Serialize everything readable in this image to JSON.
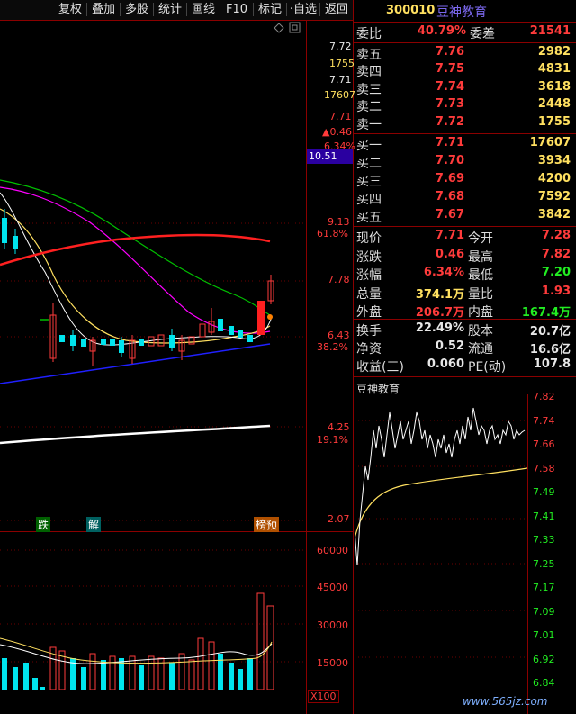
{
  "toolbar": {
    "buttons": [
      "复权",
      "叠加",
      "多股",
      "统计",
      "画线",
      "F10",
      "标记",
      "·自选",
      "返回"
    ]
  },
  "kline": {
    "price_axis_top": [
      "7.72",
      "1755",
      "7.71",
      "17607",
      "7.71",
      "▲0.46",
      "6.34%"
    ],
    "cursor_price": "10.51",
    "axis_labels": [
      {
        "price": "9.13",
        "pct": "61.8%"
      },
      {
        "price": "7.78"
      },
      {
        "price": "6.43",
        "pct": "38.2%"
      },
      {
        "price": "4.25",
        "pct": "19.1%"
      },
      {
        "price": "2.07"
      }
    ],
    "markers": [
      "跌",
      "解",
      "榜预"
    ]
  },
  "volume": {
    "axis_labels": [
      "60000",
      "45000",
      "30000",
      "15000"
    ],
    "unit": "X100"
  },
  "quote": {
    "code": "300010",
    "name": "豆神教育",
    "weibi_label": "委比",
    "weibi_value": "40.79%",
    "weicha_label": "委差",
    "weicha_value": "21541",
    "sells": [
      {
        "label": "卖五",
        "price": "7.76",
        "vol": "2982"
      },
      {
        "label": "卖四",
        "price": "7.75",
        "vol": "4831"
      },
      {
        "label": "卖三",
        "price": "7.74",
        "vol": "3618"
      },
      {
        "label": "卖二",
        "price": "7.73",
        "vol": "2448"
      },
      {
        "label": "卖一",
        "price": "7.72",
        "vol": "1755"
      }
    ],
    "buys": [
      {
        "label": "买一",
        "price": "7.71",
        "vol": "17607"
      },
      {
        "label": "买二",
        "price": "7.70",
        "vol": "3934"
      },
      {
        "label": "买三",
        "price": "7.69",
        "vol": "4200"
      },
      {
        "label": "买四",
        "price": "7.68",
        "vol": "7592"
      },
      {
        "label": "买五",
        "price": "7.67",
        "vol": "3842"
      }
    ],
    "stats": [
      {
        "l1": "现价",
        "v1": "7.71",
        "c1": "red",
        "l2": "今开",
        "v2": "7.28",
        "c2": "red"
      },
      {
        "l1": "涨跌",
        "v1": "0.46",
        "c1": "red",
        "l2": "最高",
        "v2": "7.82",
        "c2": "red"
      },
      {
        "l1": "涨幅",
        "v1": "6.34%",
        "c1": "red",
        "l2": "最低",
        "v2": "7.20",
        "c2": "green"
      },
      {
        "l1": "总量",
        "v1": "374.1万",
        "c1": "yellow",
        "l2": "量比",
        "v2": "1.93",
        "c2": "red"
      },
      {
        "l1": "外盘",
        "v1": "206.7万",
        "c1": "red",
        "l2": "内盘",
        "v2": "167.4万",
        "c2": "green"
      }
    ],
    "stats2": [
      {
        "l1": "换手",
        "v1": "22.49%",
        "l2": "股本",
        "v2": "20.7亿"
      },
      {
        "l1": "净资",
        "v1": "0.52",
        "l2": "流通",
        "v2": "16.6亿"
      },
      {
        "l1": "收益(三)",
        "v1": "0.060",
        "l2": "PE(动)",
        "v2": "107.8"
      }
    ]
  },
  "minute": {
    "title": "豆神教育",
    "axis": [
      "7.82",
      "7.74",
      "7.66",
      "7.58",
      "7.49",
      "7.41",
      "7.33",
      "7.25",
      "7.17",
      "7.09",
      "7.01",
      "6.92",
      "6.84"
    ]
  },
  "watermark": "www.565jz.com",
  "colors": {
    "up": "#ff3b3b",
    "down": "#00e5ee",
    "grid": "#8b0000",
    "ma5": "#ffffff",
    "ma10": "#ffe060",
    "ma20": "#ff00ff",
    "ma60": "#00c000",
    "ma120": "#ff2020",
    "trend": "#2020ff",
    "ma250": "#ffffff"
  }
}
